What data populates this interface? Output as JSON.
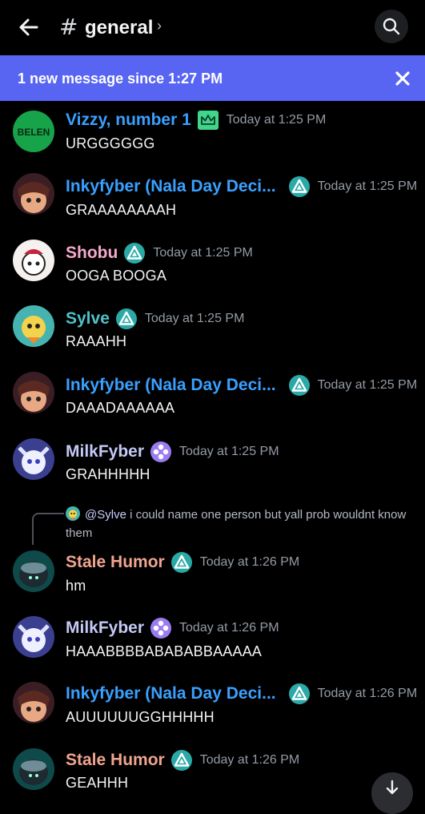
{
  "header": {
    "hash": "#",
    "title": "general",
    "chevron": "›"
  },
  "banner": {
    "text": "1 new message since 1:27 PM"
  },
  "messages": [
    {
      "author": "Vizzy, number 1",
      "color": "#3aa0ff",
      "badge": "crown-icon",
      "time": "Today at 1:25 PM",
      "text": "URGGGGGG",
      "avatar_label": "BELEN"
    },
    {
      "author": "Inkyfyber (Nala Day Deci...",
      "color": "#3aa0ff",
      "badge": "triangle-badge-icon",
      "time": "Today at 1:25 PM",
      "text": "GRAAAAAAAAH"
    },
    {
      "author": "Shobu",
      "color": "#f5a9c9",
      "badge": "triangle-badge-icon",
      "time": "Today at 1:25 PM",
      "text": "OOGA BOOGA"
    },
    {
      "author": "Sylve",
      "color": "#4fc3c8",
      "badge": "triangle-badge-icon",
      "time": "Today at 1:25 PM",
      "text": "RAAAHH"
    },
    {
      "author": "Inkyfyber (Nala Day Deci...",
      "color": "#3aa0ff",
      "badge": "triangle-badge-icon",
      "time": "Today at 1:25 PM",
      "text": "DAAADAAAAAA"
    },
    {
      "author": "MilkFyber",
      "color": "#c4c9f5",
      "badge": "flower-badge-icon",
      "time": "Today at 1:25 PM",
      "text": "GRAHHHHH"
    },
    {
      "author": "Stale Humor",
      "color": "#f0a58f",
      "badge": "triangle-badge-icon",
      "time": "Today at 1:26 PM",
      "text": "hm"
    },
    {
      "author": "MilkFyber",
      "color": "#c4c9f5",
      "badge": "flower-badge-icon",
      "time": "Today at 1:26 PM",
      "text": "HAAABBBBABABABBAAAAA"
    },
    {
      "author": "Inkyfyber (Nala Day Deci...",
      "color": "#3aa0ff",
      "badge": "triangle-badge-icon",
      "time": "Today at 1:26 PM",
      "text": "AUUUUUUGGHHHHH"
    },
    {
      "author": "Stale Humor",
      "color": "#f0a58f",
      "badge": "triangle-badge-icon",
      "time": "Today at 1:26 PM",
      "text": "GEAHHH"
    }
  ],
  "reply": {
    "mention": "@Sylve",
    "text": " i could name one person but yall prob wouldnt know them"
  }
}
